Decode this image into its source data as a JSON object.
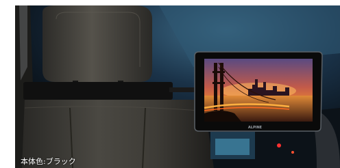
{
  "caption": "本体色:ブラック",
  "colors": {
    "background": "#ffffff",
    "seat_fabric": "#3b3a36",
    "cabin_dark": "#0c141d",
    "monitor_bezel": "#111111",
    "sunset_orange": "#e0762a",
    "sunset_sky": "#6a4a7a"
  },
  "scene": {
    "subject": "rear-seat-monitor",
    "monitor_brand_mark": "ALPINE"
  }
}
